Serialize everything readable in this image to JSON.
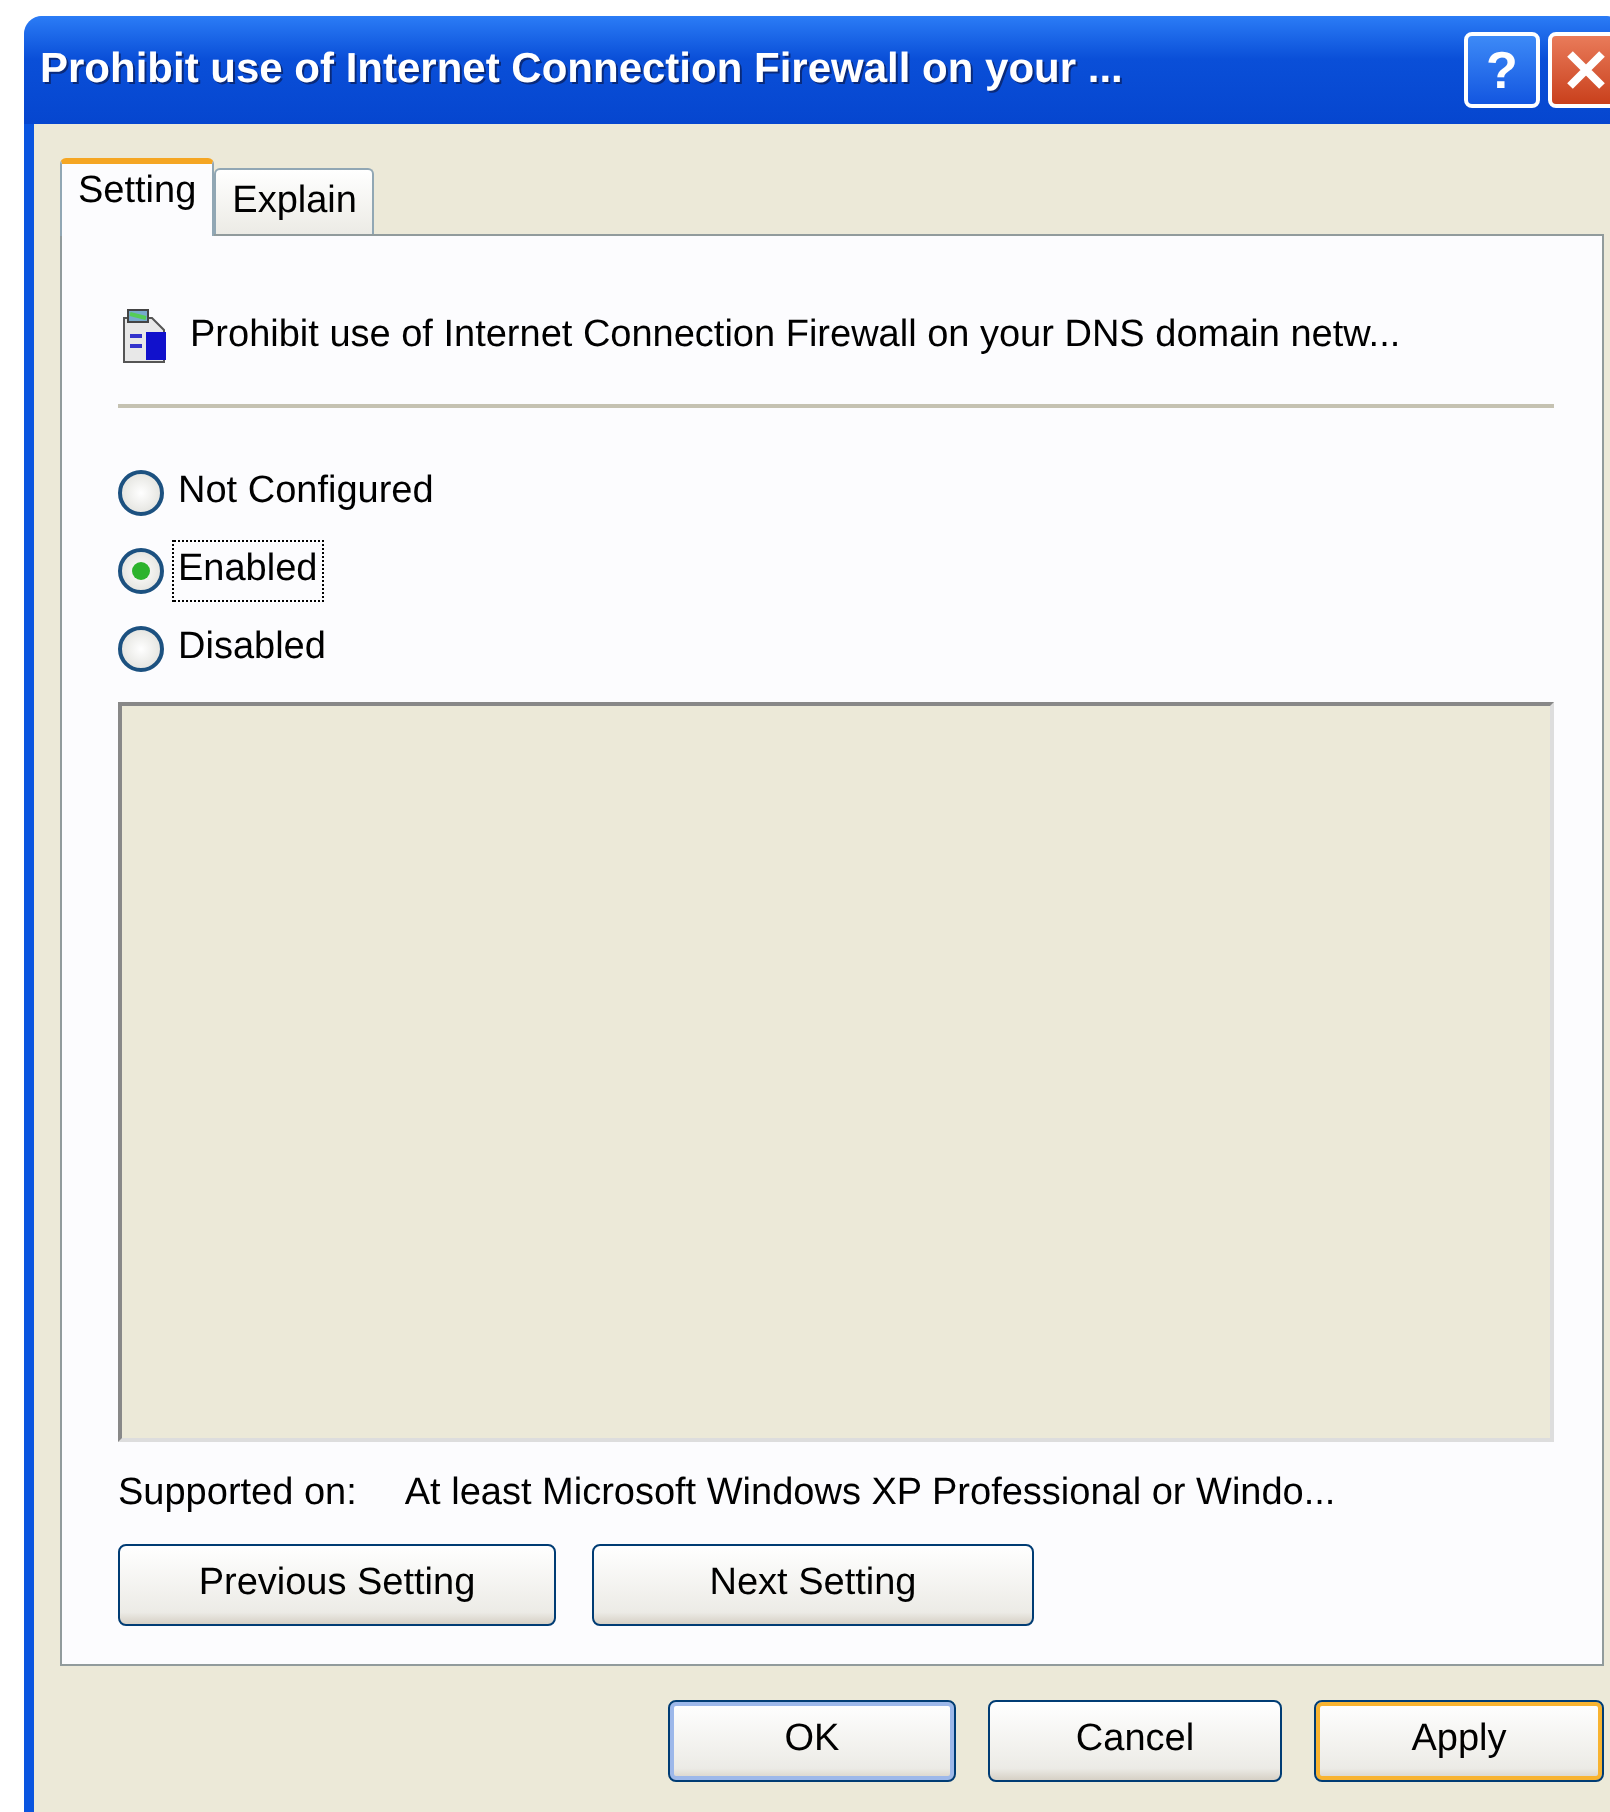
{
  "window": {
    "title": "Prohibit use of Internet Connection Firewall on your ..."
  },
  "title_buttons": [
    {
      "kind": "help",
      "label": "?"
    },
    {
      "kind": "close"
    }
  ],
  "tabs": [
    {
      "label": "Setting",
      "selected": true
    },
    {
      "label": "Explain",
      "selected": false
    }
  ],
  "policy": {
    "name": "Prohibit use of Internet Connection Firewall on your DNS domain netw..."
  },
  "options": [
    {
      "label": "Not Configured",
      "selected": false,
      "focused": false
    },
    {
      "label": "Enabled",
      "selected": true,
      "focused": true
    },
    {
      "label": "Disabled",
      "selected": false,
      "focused": false
    }
  ],
  "supported_on": {
    "label": "Supported on:",
    "value": "At least Microsoft Windows XP Professional or Windo..."
  },
  "nav_buttons": [
    {
      "label": "Previous Setting"
    },
    {
      "label": "Next Setting"
    }
  ],
  "buttons": [
    {
      "label": "OK",
      "default": true,
      "hovered": false
    },
    {
      "label": "Cancel",
      "default": false,
      "hovered": false
    },
    {
      "label": "Apply",
      "default": false,
      "hovered": true
    }
  ]
}
